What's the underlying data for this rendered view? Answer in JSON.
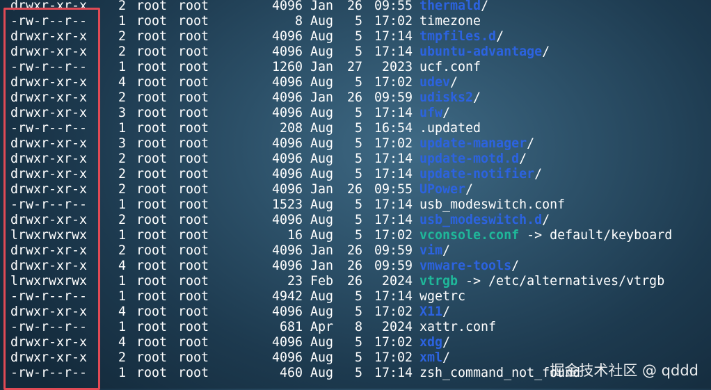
{
  "listing": [
    {
      "perm": "drwxr-xr-x",
      "links": "2",
      "owner": "root",
      "group": "root",
      "size": "4096",
      "month": "Jan",
      "day": "26",
      "time": "09:55",
      "name": "thermald",
      "type": "dir",
      "suffix": "/"
    },
    {
      "perm": "-rw-r--r--",
      "links": "1",
      "owner": "root",
      "group": "root",
      "size": "8",
      "month": "Aug",
      "day": "5",
      "time": "17:02",
      "name": "timezone",
      "type": "file",
      "suffix": ""
    },
    {
      "perm": "drwxr-xr-x",
      "links": "2",
      "owner": "root",
      "group": "root",
      "size": "4096",
      "month": "Aug",
      "day": "5",
      "time": "17:14",
      "name": "tmpfiles.d",
      "type": "dir",
      "suffix": "/"
    },
    {
      "perm": "drwxr-xr-x",
      "links": "2",
      "owner": "root",
      "group": "root",
      "size": "4096",
      "month": "Aug",
      "day": "5",
      "time": "17:14",
      "name": "ubuntu-advantage",
      "type": "dir",
      "suffix": "/"
    },
    {
      "perm": "-rw-r--r--",
      "links": "1",
      "owner": "root",
      "group": "root",
      "size": "1260",
      "month": "Jan",
      "day": "27",
      "time": "2023",
      "name": "ucf.conf",
      "type": "file",
      "suffix": ""
    },
    {
      "perm": "drwxr-xr-x",
      "links": "4",
      "owner": "root",
      "group": "root",
      "size": "4096",
      "month": "Aug",
      "day": "5",
      "time": "17:02",
      "name": "udev",
      "type": "dir",
      "suffix": "/"
    },
    {
      "perm": "drwxr-xr-x",
      "links": "2",
      "owner": "root",
      "group": "root",
      "size": "4096",
      "month": "Jan",
      "day": "26",
      "time": "09:59",
      "name": "udisks2",
      "type": "dir",
      "suffix": "/"
    },
    {
      "perm": "drwxr-xr-x",
      "links": "3",
      "owner": "root",
      "group": "root",
      "size": "4096",
      "month": "Aug",
      "day": "5",
      "time": "17:14",
      "name": "ufw",
      "type": "dir",
      "suffix": "/"
    },
    {
      "perm": "-rw-r--r--",
      "links": "1",
      "owner": "root",
      "group": "root",
      "size": "208",
      "month": "Aug",
      "day": "5",
      "time": "16:54",
      "name": ".updated",
      "type": "file",
      "suffix": ""
    },
    {
      "perm": "drwxr-xr-x",
      "links": "3",
      "owner": "root",
      "group": "root",
      "size": "4096",
      "month": "Aug",
      "day": "5",
      "time": "17:02",
      "name": "update-manager",
      "type": "dir",
      "suffix": "/"
    },
    {
      "perm": "drwxr-xr-x",
      "links": "2",
      "owner": "root",
      "group": "root",
      "size": "4096",
      "month": "Aug",
      "day": "5",
      "time": "17:14",
      "name": "update-motd.d",
      "type": "dir",
      "suffix": "/"
    },
    {
      "perm": "drwxr-xr-x",
      "links": "2",
      "owner": "root",
      "group": "root",
      "size": "4096",
      "month": "Aug",
      "day": "5",
      "time": "17:14",
      "name": "update-notifier",
      "type": "dir",
      "suffix": "/"
    },
    {
      "perm": "drwxr-xr-x",
      "links": "2",
      "owner": "root",
      "group": "root",
      "size": "4096",
      "month": "Jan",
      "day": "26",
      "time": "09:55",
      "name": "UPower",
      "type": "dir",
      "suffix": "/"
    },
    {
      "perm": "-rw-r--r--",
      "links": "1",
      "owner": "root",
      "group": "root",
      "size": "1523",
      "month": "Aug",
      "day": "5",
      "time": "17:14",
      "name": "usb_modeswitch.conf",
      "type": "file",
      "suffix": ""
    },
    {
      "perm": "drwxr-xr-x",
      "links": "2",
      "owner": "root",
      "group": "root",
      "size": "4096",
      "month": "Aug",
      "day": "5",
      "time": "17:14",
      "name": "usb_modeswitch.d",
      "type": "dir",
      "suffix": "/"
    },
    {
      "perm": "lrwxrwxrwx",
      "links": "1",
      "owner": "root",
      "group": "root",
      "size": "16",
      "month": "Aug",
      "day": "5",
      "time": "17:02",
      "name": "vconsole.conf",
      "type": "link",
      "suffix": " -> default/keyboard"
    },
    {
      "perm": "drwxr-xr-x",
      "links": "2",
      "owner": "root",
      "group": "root",
      "size": "4096",
      "month": "Jan",
      "day": "26",
      "time": "09:59",
      "name": "vim",
      "type": "dir",
      "suffix": "/"
    },
    {
      "perm": "drwxr-xr-x",
      "links": "4",
      "owner": "root",
      "group": "root",
      "size": "4096",
      "month": "Jan",
      "day": "26",
      "time": "09:59",
      "name": "vmware-tools",
      "type": "dir",
      "suffix": "/"
    },
    {
      "perm": "lrwxrwxrwx",
      "links": "1",
      "owner": "root",
      "group": "root",
      "size": "23",
      "month": "Feb",
      "day": "26",
      "time": "2024",
      "name": "vtrgb",
      "type": "link",
      "suffix": " -> /etc/alternatives/vtrgb"
    },
    {
      "perm": "-rw-r--r--",
      "links": "1",
      "owner": "root",
      "group": "root",
      "size": "4942",
      "month": "Aug",
      "day": "5",
      "time": "17:14",
      "name": "wgetrc",
      "type": "file",
      "suffix": ""
    },
    {
      "perm": "drwxr-xr-x",
      "links": "4",
      "owner": "root",
      "group": "root",
      "size": "4096",
      "month": "Aug",
      "day": "5",
      "time": "17:02",
      "name": "X11",
      "type": "dir",
      "suffix": "/"
    },
    {
      "perm": "-rw-r--r--",
      "links": "1",
      "owner": "root",
      "group": "root",
      "size": "681",
      "month": "Apr",
      "day": "8",
      "time": "2024",
      "name": "xattr.conf",
      "type": "file",
      "suffix": ""
    },
    {
      "perm": "drwxr-xr-x",
      "links": "4",
      "owner": "root",
      "group": "root",
      "size": "4096",
      "month": "Aug",
      "day": "5",
      "time": "17:02",
      "name": "xdg",
      "type": "dir",
      "suffix": "/"
    },
    {
      "perm": "drwxr-xr-x",
      "links": "2",
      "owner": "root",
      "group": "root",
      "size": "4096",
      "month": "Aug",
      "day": "5",
      "time": "17:02",
      "name": "xml",
      "type": "dir",
      "suffix": "/"
    },
    {
      "perm": "-rw-r--r--",
      "links": "1",
      "owner": "root",
      "group": "root",
      "size": "460",
      "month": "Aug",
      "day": "5",
      "time": "17:14",
      "name": "zsh_command_not_found",
      "type": "file",
      "suffix": ""
    }
  ],
  "colors": {
    "directory": "#2c63e0",
    "symlink": "#1fb89a",
    "text": "#ffffff",
    "highlight_border": "#e04a55"
  },
  "watermark": "掘金技术社区 @ qddd"
}
